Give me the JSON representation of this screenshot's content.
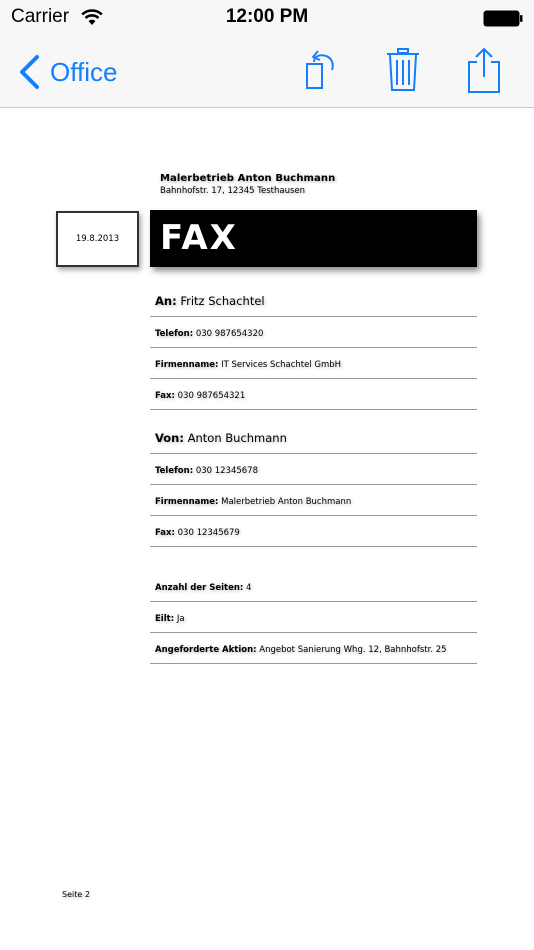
{
  "status_bar": {
    "carrier": "Carrier",
    "time": "12:00 PM"
  },
  "nav": {
    "back_label": "Office",
    "accent_color": "#157efb",
    "icons": [
      "rotate-icon",
      "trash-icon",
      "share-icon"
    ]
  },
  "document": {
    "company_name": "Malerbetrieb Anton Buchmann",
    "company_address": "Bahnhofstr. 17, 12345 Testhausen",
    "date": "19.8.2013",
    "title": "FAX",
    "recipient": {
      "to_label": "An:",
      "to_value": "Fritz Schachtel",
      "phone_label": "Telefon:",
      "phone_value": "030 987654320",
      "company_label": "Firmenname:",
      "company_value": "IT Services Schachtel GmbH",
      "fax_label": "Fax:",
      "fax_value": "030 987654321"
    },
    "sender": {
      "from_label": "Von:",
      "from_value": "Anton Buchmann",
      "phone_label": "Telefon:",
      "phone_value": "030 12345678",
      "company_label": "Firmenname:",
      "company_value": "Malerbetrieb Anton Buchmann",
      "fax_label": "Fax:",
      "fax_value": "030 12345679"
    },
    "details": {
      "pages_label": "Anzahl der Seiten:",
      "pages_value": "4",
      "urgent_label": "Eilt:",
      "urgent_value": "Ja",
      "action_label": "Angeforderte Aktion:",
      "action_value": "Angebot Sanierung Whg. 12, Bahnhofstr. 25"
    },
    "page_label": "Seite 2"
  }
}
